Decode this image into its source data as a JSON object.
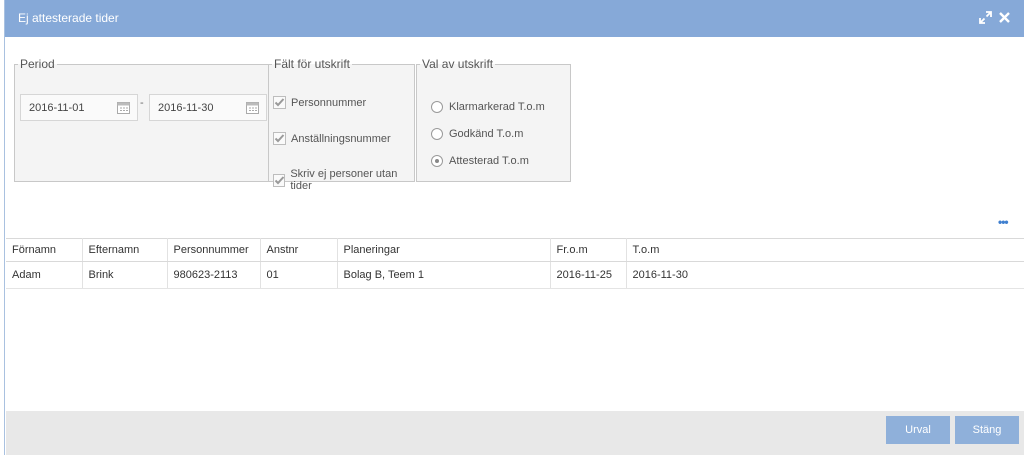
{
  "dialog": {
    "title": "Ej attesterade tider"
  },
  "period": {
    "legend": "Period",
    "from": "2016-11-01",
    "to": "2016-11-30",
    "separator": "-"
  },
  "falt": {
    "legend": "Fält för utskrift",
    "items": [
      {
        "label": "Personnummer",
        "checked": true
      },
      {
        "label": "Anställningsnummer",
        "checked": true
      },
      {
        "label": "Skriv ej personer utan tider",
        "checked": true
      }
    ]
  },
  "val": {
    "legend": "Val av utskrift",
    "options": [
      {
        "label": "Klarmarkerad T.o.m",
        "selected": false
      },
      {
        "label": "Godkänd T.o.m",
        "selected": false
      },
      {
        "label": "Attesterad T.o.m",
        "selected": true
      }
    ]
  },
  "table": {
    "columns": [
      "Förnamn",
      "Efternamn",
      "Personnummer",
      "Anstnr",
      "Planeringar",
      "Fr.o.m",
      "T.o.m"
    ],
    "rows": [
      [
        "Adam",
        "Brink",
        "980623-2113",
        "01",
        "Bolag B, Teem 1",
        "2016-11-25",
        "2016-11-30"
      ]
    ]
  },
  "footer": {
    "urval": "Urval",
    "stang": "Stäng"
  },
  "icons": {
    "maximize": "maximize-icon",
    "close": "close-icon",
    "calendar": "calendar-icon",
    "more": "more-dots-icon"
  },
  "colors": {
    "titlebar": "#86a9d8",
    "button": "#8fb0da",
    "accent": "#3f7fcf"
  }
}
